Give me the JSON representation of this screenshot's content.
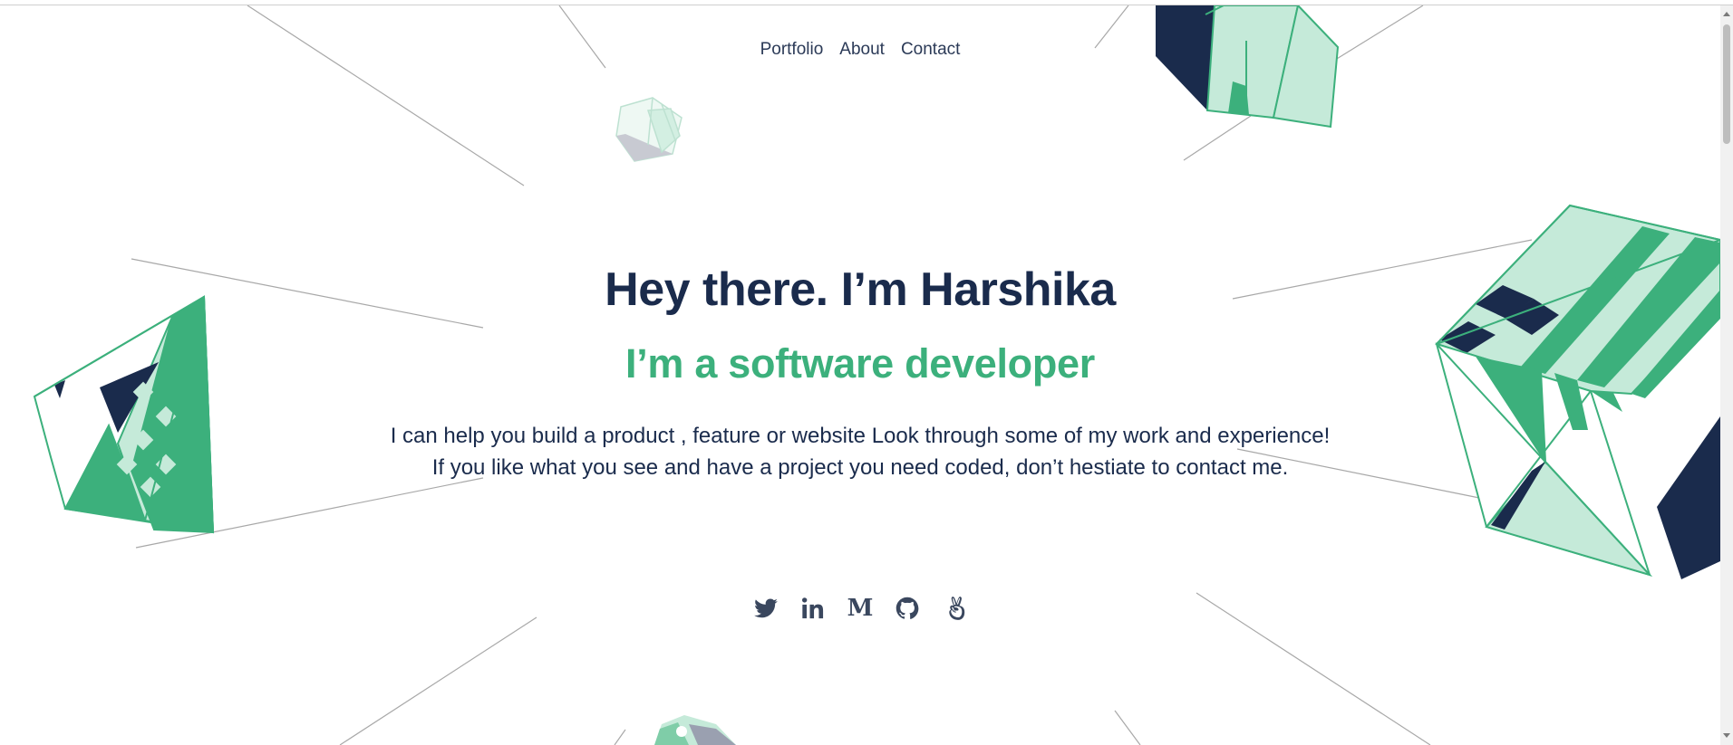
{
  "nav": {
    "items": [
      {
        "label": "Portfolio"
      },
      {
        "label": "About"
      },
      {
        "label": "Contact"
      }
    ]
  },
  "hero": {
    "title": "Hey there. I’m Harshika",
    "subtitle": "I’m a software developer",
    "description": "I can help you build a product , feature or website Look through some of my work and experience! If you like what you see and have a project you need coded, don’t hestiate to contact me."
  },
  "social": [
    {
      "icon": "twitter-icon"
    },
    {
      "icon": "linkedin-icon"
    },
    {
      "icon": "medium-icon",
      "glyph": "M"
    },
    {
      "icon": "github-icon"
    },
    {
      "icon": "angellist-icon"
    }
  ],
  "colors": {
    "navy": "#1a2b4c",
    "green": "#3cb07c",
    "mint": "#c5ead9",
    "line": "#9a9a9a"
  }
}
